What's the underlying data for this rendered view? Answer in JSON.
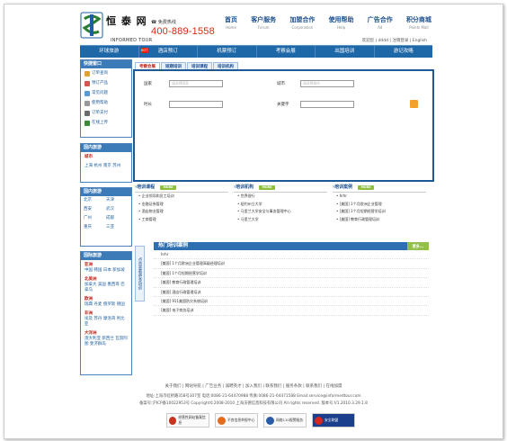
{
  "brand": {
    "name_cn": "恒 泰 网",
    "name_en": "INFORMED TOUR",
    "hotline_label": "免费热线",
    "hotline": "400-889-1558"
  },
  "topnav": [
    {
      "cn": "首页",
      "en": "Home"
    },
    {
      "cn": "客户服务",
      "en": "Forum"
    },
    {
      "cn": "加盟合作",
      "en": "Corporation"
    },
    {
      "cn": "使用帮助",
      "en": "Help"
    },
    {
      "cn": "广告合作",
      "en": "Ad"
    },
    {
      "cn": "积分商城",
      "en": "Points Mall"
    }
  ],
  "welcome": "欢迎您 | dddd | 注销登录 | English",
  "mainnav": [
    "环球旅游",
    "酒店预订",
    "机票预订",
    "考察会展",
    "出国培训",
    "游记攻略"
  ],
  "hot_label": "HOT",
  "quick": {
    "title": "快捷窗口",
    "items": [
      "订单查询",
      "预订产品",
      "常见问题",
      "使用帮助",
      "订单支付",
      "在线上传"
    ]
  },
  "domestic": {
    "title": "国内旅游",
    "sub": "城市",
    "cities": "上海  杭州  南京  苏州"
  },
  "hk": {
    "title": "国内旅游",
    "items": [
      "北京",
      "天津",
      "西安",
      "武汉",
      "广州",
      "成都",
      "重庆",
      "三亚"
    ]
  },
  "intl": {
    "title": "国际旅游",
    "groups": [
      {
        "name": "亚洲",
        "cities": "中国  韩国  日本  新加坡"
      },
      {
        "name": "北美洲",
        "cities": "加拿大  美国  墨西哥  巴拿马"
      },
      {
        "name": "欧洲",
        "cities": "瑞典  丹麦  俄罗斯  德国"
      },
      {
        "name": "非洲",
        "cities": "埃及  苏丹  摩洛哥  利比亚"
      },
      {
        "name": "大洋洲",
        "cities": "澳大利亚  新西兰  瓦努阿图  斐济群岛"
      }
    ]
  },
  "tabs": [
    "考察会展",
    "短期培训",
    "培训课程",
    "培训机构"
  ],
  "form": {
    "country_label": "国家",
    "country_ph": "请选择国家",
    "city_label": "城市",
    "city_ph": "请选择城市",
    "date_label": "时长",
    "keyword_label": "关键字"
  },
  "col_courses": {
    "title": "培训课程",
    "more": "MORE",
    "items": [
      "企业领导和员工培训",
      "金融证券管理",
      "酒店物业管理",
      "工商管理"
    ]
  },
  "col_orgs": {
    "title": "培训机构",
    "more": "MORE",
    "items": [
      "世界银行",
      "纽约州立大学",
      "马里兰大学安全与事务管理中心",
      "马里兰大学"
    ]
  },
  "col_cases": {
    "title": "培训案例",
    "more": "MORE",
    "items": [
      "hrhr",
      "[美国] 1个月欧洲企业管理",
      "[美国] 1个月短期经营学培训",
      "[美国] 教育行政管理培训"
    ]
  },
  "vtab": "点击查看更多培训",
  "hotcase": {
    "title": "热门培训案例",
    "more": "更多...",
    "items": [
      "hrhr",
      "[美国] 1个月欧洲企业管理高级经理培训",
      "[美国] 1个月短期经营学培训",
      "[美国] 教育行政管理培训",
      "[美国] 酒店行政管理培训",
      "[美国] 911美国防灾系统培训",
      "[美国] 电子商务培训"
    ]
  },
  "footer": {
    "links": "关于我们  |  网站导航  |  广告业务  |  诚聘英才  |  加入我们  |  联系我们  |  服务条款  |  联系我们  |  在线加盟",
    "address": "地址:上海市虹桥路358号307室  电话:0086-21-64470988  传真:0086-21-64471588  Email:service@informedtour.com",
    "copyright": "备案号:沪ICP备10022953号  Copyright©2008-2010  上海沃德信息科技有限公司  All rights reserved.  版本号:V1.2010.3.29.1.8",
    "badges": [
      "经营性网站备案信息",
      "不良信息举报中心",
      "网络110报警服务",
      "安全联盟"
    ]
  }
}
